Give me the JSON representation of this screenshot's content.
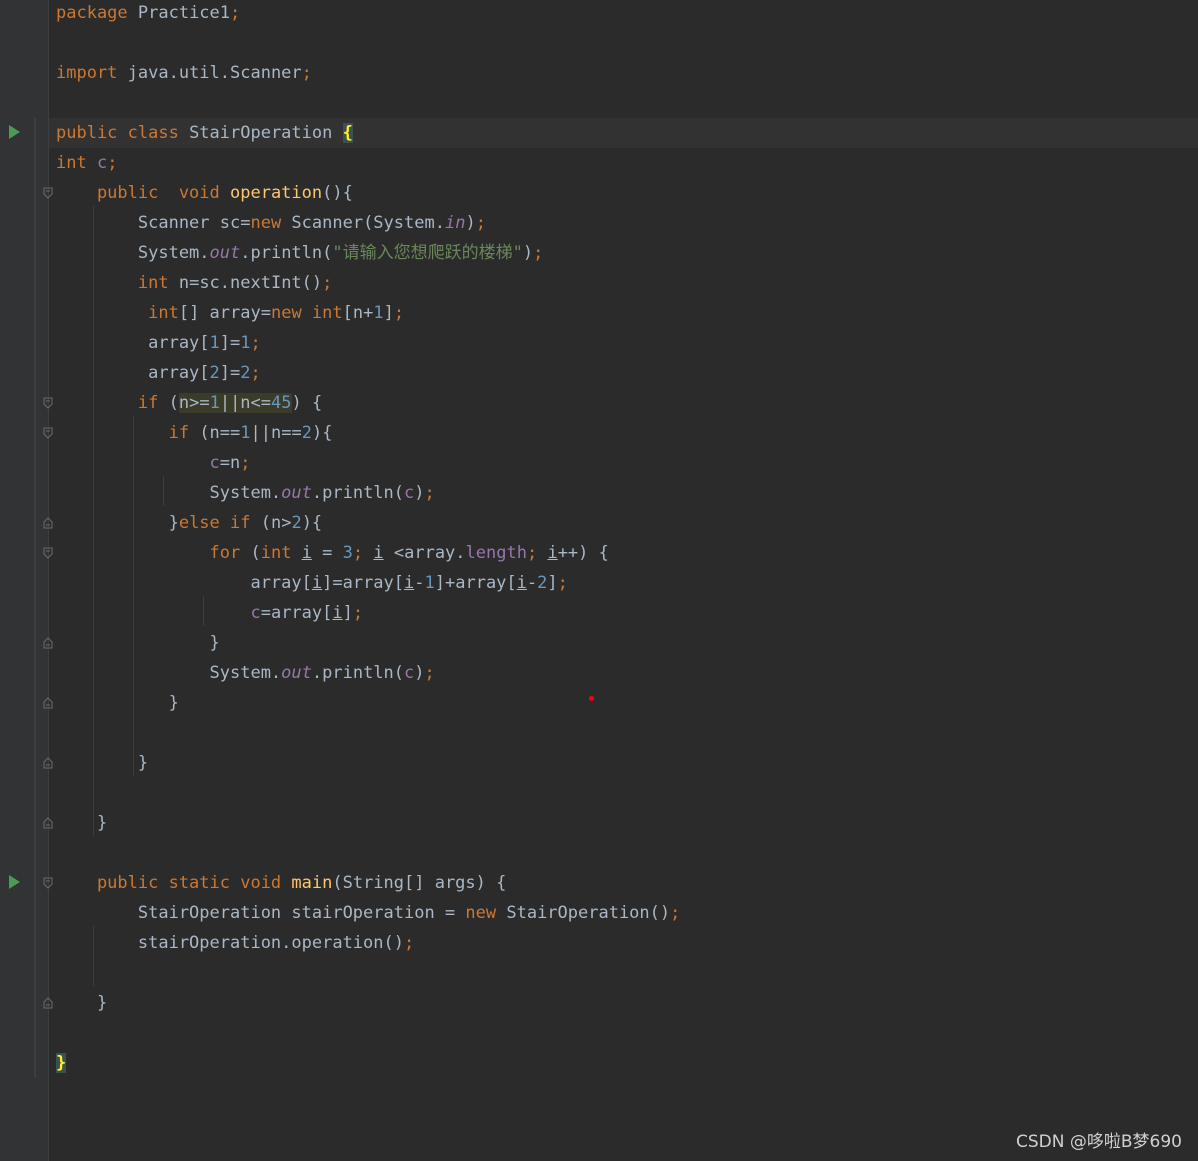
{
  "editor": {
    "lines": [
      {
        "tokens": [
          {
            "t": "package ",
            "c": "kw"
          },
          {
            "t": "Practice1",
            "c": "plain"
          },
          {
            "t": ";",
            "c": "semi"
          }
        ]
      },
      {
        "tokens": []
      },
      {
        "tokens": [
          {
            "t": "import ",
            "c": "kw"
          },
          {
            "t": "java.util.Scanner",
            "c": "plain"
          },
          {
            "t": ";",
            "c": "semi"
          }
        ]
      },
      {
        "tokens": []
      },
      {
        "tokens": [
          {
            "t": "public class ",
            "c": "kw"
          },
          {
            "t": "StairOperation ",
            "c": "plain"
          },
          {
            "t": "{",
            "c": "brace-hl"
          }
        ]
      },
      {
        "tokens": [
          {
            "t": "int ",
            "c": "kw"
          },
          {
            "t": "c",
            "c": "field"
          },
          {
            "t": ";",
            "c": "semi"
          }
        ]
      },
      {
        "tokens": [
          {
            "t": "    public  void ",
            "c": "kw"
          },
          {
            "t": "operation",
            "c": "method"
          },
          {
            "t": "(){",
            "c": "plain"
          }
        ]
      },
      {
        "tokens": [
          {
            "t": "        Scanner sc=",
            "c": "plain"
          },
          {
            "t": "new ",
            "c": "kw"
          },
          {
            "t": "Scanner(System.",
            "c": "plain"
          },
          {
            "t": "in",
            "c": "static-field"
          },
          {
            "t": ")",
            "c": "plain"
          },
          {
            "t": ";",
            "c": "semi"
          }
        ]
      },
      {
        "tokens": [
          {
            "t": "        System.",
            "c": "plain"
          },
          {
            "t": "out",
            "c": "static-field"
          },
          {
            "t": ".println(",
            "c": "plain"
          },
          {
            "t": "\"请输入您想爬跃的楼梯\"",
            "c": "str"
          },
          {
            "t": ")",
            "c": "plain"
          },
          {
            "t": ";",
            "c": "semi"
          }
        ]
      },
      {
        "tokens": [
          {
            "t": "        ",
            "c": "plain"
          },
          {
            "t": "int ",
            "c": "kw"
          },
          {
            "t": "n=sc.nextInt()",
            "c": "plain"
          },
          {
            "t": ";",
            "c": "semi"
          }
        ]
      },
      {
        "tokens": [
          {
            "t": "         ",
            "c": "plain"
          },
          {
            "t": "int",
            "c": "kw"
          },
          {
            "t": "[] array=",
            "c": "plain"
          },
          {
            "t": "new ",
            "c": "kw"
          },
          {
            "t": "int",
            "c": "kw"
          },
          {
            "t": "[n+",
            "c": "plain"
          },
          {
            "t": "1",
            "c": "num"
          },
          {
            "t": "]",
            "c": "plain"
          },
          {
            "t": ";",
            "c": "semi"
          }
        ]
      },
      {
        "tokens": [
          {
            "t": "         array[",
            "c": "plain"
          },
          {
            "t": "1",
            "c": "num"
          },
          {
            "t": "]=",
            "c": "plain"
          },
          {
            "t": "1",
            "c": "num"
          },
          {
            "t": ";",
            "c": "semi"
          }
        ]
      },
      {
        "tokens": [
          {
            "t": "         array[",
            "c": "plain"
          },
          {
            "t": "2",
            "c": "num"
          },
          {
            "t": "]=",
            "c": "plain"
          },
          {
            "t": "2",
            "c": "num"
          },
          {
            "t": ";",
            "c": "semi"
          }
        ]
      },
      {
        "tokens": [
          {
            "t": "        ",
            "c": "plain"
          },
          {
            "t": "if ",
            "c": "kw"
          },
          {
            "t": "(",
            "c": "plain"
          },
          {
            "t": "n>=",
            "c": "plain search-hl"
          },
          {
            "t": "1",
            "c": "num search-hl"
          },
          {
            "t": "||n<=",
            "c": "plain search-hl"
          },
          {
            "t": "45",
            "c": "num search-hl"
          },
          {
            "t": ") {",
            "c": "plain"
          }
        ]
      },
      {
        "tokens": [
          {
            "t": "           ",
            "c": "plain"
          },
          {
            "t": "if ",
            "c": "kw"
          },
          {
            "t": "(n==",
            "c": "plain"
          },
          {
            "t": "1",
            "c": "num"
          },
          {
            "t": "||n==",
            "c": "plain"
          },
          {
            "t": "2",
            "c": "num"
          },
          {
            "t": "){",
            "c": "plain"
          }
        ]
      },
      {
        "tokens": [
          {
            "t": "               ",
            "c": "plain"
          },
          {
            "t": "c",
            "c": "field"
          },
          {
            "t": "=n",
            "c": "plain"
          },
          {
            "t": ";",
            "c": "semi"
          }
        ]
      },
      {
        "tokens": [
          {
            "t": "               System.",
            "c": "plain"
          },
          {
            "t": "out",
            "c": "static-field"
          },
          {
            "t": ".println(",
            "c": "plain"
          },
          {
            "t": "c",
            "c": "field"
          },
          {
            "t": ")",
            "c": "plain"
          },
          {
            "t": ";",
            "c": "semi"
          }
        ]
      },
      {
        "tokens": [
          {
            "t": "           }",
            "c": "plain"
          },
          {
            "t": "else if ",
            "c": "kw"
          },
          {
            "t": "(n>",
            "c": "plain"
          },
          {
            "t": "2",
            "c": "num"
          },
          {
            "t": "){",
            "c": "plain"
          }
        ]
      },
      {
        "tokens": [
          {
            "t": "               ",
            "c": "plain"
          },
          {
            "t": "for ",
            "c": "kw"
          },
          {
            "t": "(",
            "c": "plain"
          },
          {
            "t": "int ",
            "c": "kw"
          },
          {
            "t": "i",
            "c": "plain ul"
          },
          {
            "t": " = ",
            "c": "plain"
          },
          {
            "t": "3",
            "c": "num"
          },
          {
            "t": "; ",
            "c": "semi"
          },
          {
            "t": "i",
            "c": "plain ul"
          },
          {
            "t": " <array.",
            "c": "plain"
          },
          {
            "t": "length",
            "c": "field"
          },
          {
            "t": "; ",
            "c": "semi"
          },
          {
            "t": "i",
            "c": "plain ul"
          },
          {
            "t": "++) {",
            "c": "plain"
          }
        ]
      },
      {
        "tokens": [
          {
            "t": "                   array[",
            "c": "plain"
          },
          {
            "t": "i",
            "c": "plain ul"
          },
          {
            "t": "]=array[",
            "c": "plain"
          },
          {
            "t": "i",
            "c": "plain ul"
          },
          {
            "t": "-",
            "c": "plain"
          },
          {
            "t": "1",
            "c": "num"
          },
          {
            "t": "]+array[",
            "c": "plain"
          },
          {
            "t": "i",
            "c": "plain ul"
          },
          {
            "t": "-",
            "c": "plain"
          },
          {
            "t": "2",
            "c": "num"
          },
          {
            "t": "]",
            "c": "plain"
          },
          {
            "t": ";",
            "c": "semi"
          }
        ]
      },
      {
        "tokens": [
          {
            "t": "                   ",
            "c": "plain"
          },
          {
            "t": "c",
            "c": "field"
          },
          {
            "t": "=array[",
            "c": "plain"
          },
          {
            "t": "i",
            "c": "plain ul"
          },
          {
            "t": "]",
            "c": "plain"
          },
          {
            "t": ";",
            "c": "semi"
          }
        ]
      },
      {
        "tokens": [
          {
            "t": "               }",
            "c": "plain"
          }
        ]
      },
      {
        "tokens": [
          {
            "t": "               System.",
            "c": "plain"
          },
          {
            "t": "out",
            "c": "static-field"
          },
          {
            "t": ".println(",
            "c": "plain"
          },
          {
            "t": "c",
            "c": "field"
          },
          {
            "t": ")",
            "c": "plain"
          },
          {
            "t": ";",
            "c": "semi"
          }
        ]
      },
      {
        "tokens": [
          {
            "t": "           }",
            "c": "plain"
          }
        ]
      },
      {
        "tokens": []
      },
      {
        "tokens": [
          {
            "t": "        }",
            "c": "plain"
          }
        ]
      },
      {
        "tokens": []
      },
      {
        "tokens": [
          {
            "t": "    }",
            "c": "plain"
          }
        ]
      },
      {
        "tokens": []
      },
      {
        "tokens": [
          {
            "t": "    public static void ",
            "c": "kw"
          },
          {
            "t": "main",
            "c": "method"
          },
          {
            "t": "(String[] args) {",
            "c": "plain"
          }
        ]
      },
      {
        "tokens": [
          {
            "t": "        StairOperation stairOperation = ",
            "c": "plain"
          },
          {
            "t": "new ",
            "c": "kw"
          },
          {
            "t": "StairOperation()",
            "c": "plain"
          },
          {
            "t": ";",
            "c": "semi"
          }
        ]
      },
      {
        "tokens": [
          {
            "t": "        stairOperation.operation()",
            "c": "plain"
          },
          {
            "t": ";",
            "c": "semi"
          }
        ]
      },
      {
        "tokens": []
      },
      {
        "tokens": [
          {
            "t": "    }",
            "c": "plain"
          }
        ]
      },
      {
        "tokens": []
      },
      {
        "tokens": [
          {
            "t": "}",
            "c": "brace-hl"
          }
        ]
      }
    ]
  },
  "watermark": "CSDN @哆啦B梦690"
}
